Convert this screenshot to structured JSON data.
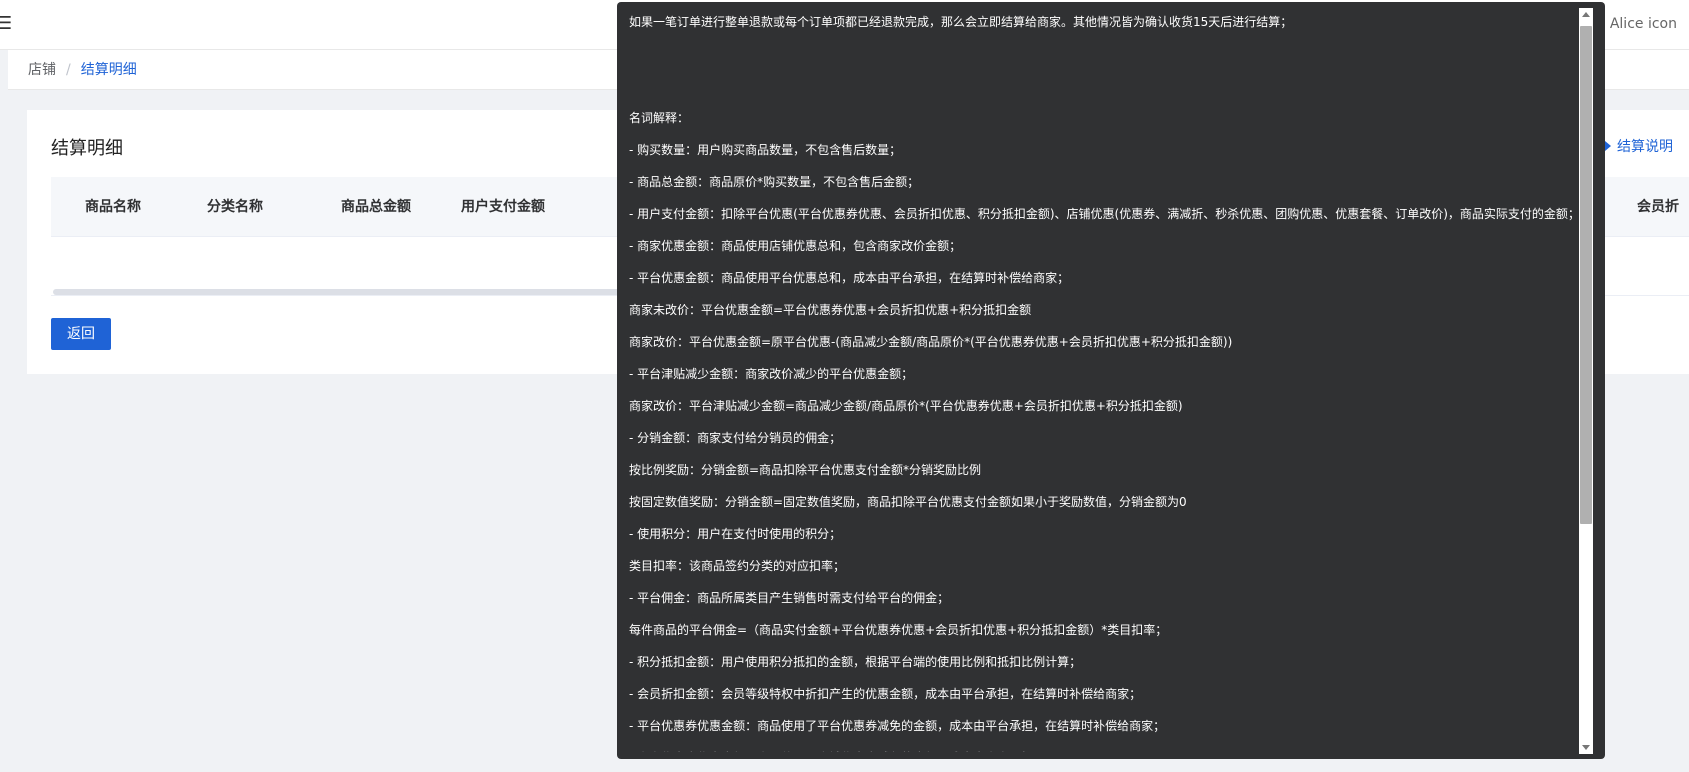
{
  "header": {
    "menu_icon": "menu-icon",
    "user": "Alice icon"
  },
  "breadcrumb": {
    "root": "店铺",
    "separator": "/",
    "current": "结算明细"
  },
  "card": {
    "title": "结算明细",
    "explain_link": "结算说明",
    "columns": [
      "商品名称",
      "分类名称",
      "商品总金额",
      "用户支付金额",
      "会员折"
    ],
    "back_button": "返回"
  },
  "tooltip": {
    "lines": [
      "如果一笔订单进行整单退款或每个订单项都已经退款完成，那么会立即结算给商家。其他情况皆为确认收货15天后进行结算；",
      "",
      "",
      "名词解释：",
      "- 购买数量：用户购买商品数量，不包含售后数量；",
      "- 商品总金额：商品原价*购买数量，不包含售后金额；",
      "- 用户支付金额：扣除平台优惠(平台优惠券优惠、会员折扣优惠、积分抵扣金额)、店铺优惠(优惠券、满减折、秒杀优惠、团购优惠、优惠套餐、订单改价)，商品实际支付的金额；",
      "- 商家优惠金额：商品使用店铺优惠总和，包含商家改价金额；",
      "- 平台优惠金额：商品使用平台优惠总和，成本由平台承担，在结算时补偿给商家；",
      "   商家未改价：平台优惠金额=平台优惠券优惠+会员折扣优惠+积分抵扣金额",
      "   商家改价：平台优惠金额=原平台优惠-(商品减少金额/商品原价*(平台优惠券优惠+会员折扣优惠+积分抵扣金额))",
      "- 平台津贴减少金额：商家改价减少的平台优惠金额；",
      "   商家改价：平台津贴减少金额=商品减少金额/商品原价*(平台优惠券优惠+会员折扣优惠+积分抵扣金额)",
      "- 分销金额：商家支付给分销员的佣金；",
      "   按比例奖励：分销金额=商品扣除平台优惠支付金额*分销奖励比例",
      "   按固定数值奖励：分销金额=固定数值奖励，商品扣除平台优惠支付金额如果小于奖励数值，分销金额为0",
      "- 使用积分：用户在支付时使用的积分；",
      "类目扣率：该商品签约分类的对应扣率；",
      "- 平台佣金：商品所属类目产生销售时需支付给平台的佣金；",
      "每件商品的平台佣金=（商品实付金额+平台优惠券优惠+会员折扣优惠+积分抵扣金额）*类目扣率；",
      "- 积分抵扣金额：用户使用积分抵扣的金额，根据平台端的使用比例和抵扣比例计算；",
      "- 会员折扣金额：会员等级特权中折扣产生的优惠金额，成本由平台承担，在结算时补偿给商家；",
      "- 平台优惠券优惠金额：商品使用了平台优惠券减免的金额，成本由平台承担，在结算时补偿给商家；",
      "- 商家优惠券优惠金额：商品使用了店铺优惠券减免的金额，成本由商家承担；"
    ]
  }
}
